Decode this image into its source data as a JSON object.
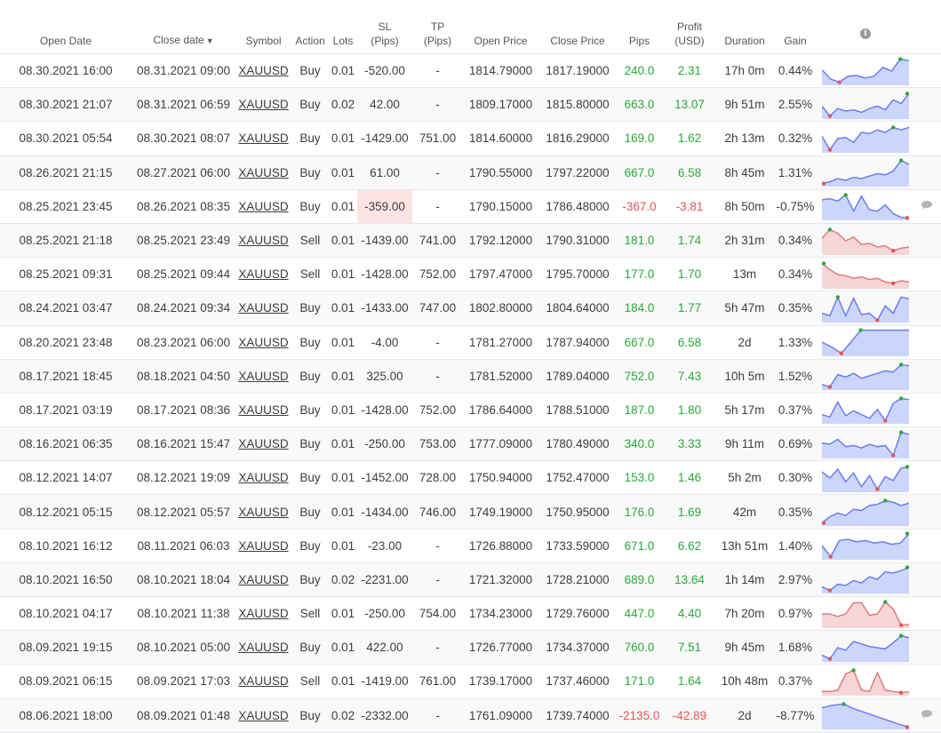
{
  "headers": {
    "open_date": "Open Date",
    "close_date": "Close date",
    "sort_indicator": "▼",
    "symbol": "Symbol",
    "action": "Action",
    "lots": "Lots",
    "sl": "SL",
    "sl_unit": "(Pips)",
    "tp": "TP",
    "tp_unit": "(Pips)",
    "open_price": "Open Price",
    "close_price": "Close Price",
    "pips": "Pips",
    "profit": "Profit",
    "profit_unit": "(USD)",
    "duration": "Duration",
    "gain": "Gain",
    "info_glyph": "i"
  },
  "colors": {
    "positive": "#2aa83a",
    "negative": "#e85454",
    "buy_line": "#6a7ef0",
    "buy_fill": "#ccd6fb",
    "sell_line": "#e27a7a",
    "sell_fill": "#f6d6d6",
    "marker_max": "#2aa83a",
    "marker_min": "#e85454"
  },
  "trades": [
    {
      "open": "08.30.2021 16:00",
      "close": "08.31.2021 09:00",
      "symbol": "XAUUSD",
      "action": "Buy",
      "lots": "0.01",
      "sl": "-520.00",
      "tp": "-",
      "open_price": "1814.79000",
      "close_price": "1817.19000",
      "pips": "240.0",
      "profit": "2.31",
      "duration": "17h 0m",
      "gain": "0.44%",
      "result": "win",
      "sl_highlight": false,
      "comment": false,
      "spark": [
        0.55,
        0.18,
        0.05,
        0.3,
        0.32,
        0.22,
        0.3,
        0.65,
        0.5,
        0.98,
        0.92
      ]
    },
    {
      "open": "08.30.2021 21:07",
      "close": "08.31.2021 06:59",
      "symbol": "XAUUSD",
      "action": "Buy",
      "lots": "0.02",
      "sl": "42.00",
      "tp": "-",
      "open_price": "1809.17000",
      "close_price": "1815.80000",
      "pips": "663.0",
      "profit": "13.07",
      "duration": "9h 51m",
      "gain": "2.55%",
      "result": "win",
      "sl_highlight": false,
      "comment": false,
      "spark": [
        0.45,
        0.05,
        0.35,
        0.25,
        0.3,
        0.2,
        0.35,
        0.45,
        0.3,
        0.7,
        0.55,
        0.95
      ]
    },
    {
      "open": "08.30.2021 05:54",
      "close": "08.30.2021 08:07",
      "symbol": "XAUUSD",
      "action": "Buy",
      "lots": "0.01",
      "sl": "-1429.00",
      "tp": "751.00",
      "open_price": "1814.60000",
      "close_price": "1816.29000",
      "pips": "169.0",
      "profit": "1.62",
      "duration": "2h 13m",
      "gain": "0.32%",
      "result": "win",
      "sl_highlight": false,
      "comment": false,
      "spark": [
        0.6,
        0.05,
        0.5,
        0.55,
        0.35,
        0.75,
        0.7,
        0.85,
        0.75,
        0.95,
        0.85,
        0.95
      ]
    },
    {
      "open": "08.26.2021 21:15",
      "close": "08.27.2021 06:00",
      "symbol": "XAUUSD",
      "action": "Buy",
      "lots": "0.01",
      "sl": "61.00",
      "tp": "-",
      "open_price": "1790.55000",
      "close_price": "1797.22000",
      "pips": "667.0",
      "profit": "6.58",
      "duration": "8h 45m",
      "gain": "1.31%",
      "result": "win",
      "sl_highlight": false,
      "comment": false,
      "spark": [
        0.05,
        0.12,
        0.25,
        0.18,
        0.3,
        0.25,
        0.35,
        0.45,
        0.4,
        0.55,
        0.98,
        0.82
      ]
    },
    {
      "open": "08.25.2021 23:45",
      "close": "08.26.2021 08:35",
      "symbol": "XAUUSD",
      "action": "Buy",
      "lots": "0.01",
      "sl": "-359.00",
      "tp": "-",
      "open_price": "1790.15000",
      "close_price": "1786.48000",
      "pips": "-367.0",
      "profit": "-3.81",
      "duration": "8h 50m",
      "gain": "-0.75%",
      "result": "loss",
      "sl_highlight": true,
      "comment": true,
      "spark": [
        0.75,
        0.8,
        0.7,
        0.95,
        0.3,
        0.9,
        0.35,
        0.3,
        0.55,
        0.2,
        0.05,
        0.03
      ]
    },
    {
      "open": "08.25.2021 21:18",
      "close": "08.25.2021 23:49",
      "symbol": "XAUUSD",
      "action": "Sell",
      "lots": "0.01",
      "sl": "-1439.00",
      "tp": "741.00",
      "open_price": "1792.12000",
      "close_price": "1790.31000",
      "pips": "181.0",
      "profit": "1.74",
      "duration": "2h 31m",
      "gain": "0.34%",
      "result": "win",
      "sl_highlight": false,
      "comment": false,
      "spark": [
        0.6,
        0.95,
        0.8,
        0.5,
        0.65,
        0.35,
        0.4,
        0.25,
        0.3,
        0.1,
        0.2,
        0.25
      ]
    },
    {
      "open": "08.25.2021 09:31",
      "close": "08.25.2021 09:44",
      "symbol": "XAUUSD",
      "action": "Sell",
      "lots": "0.01",
      "sl": "-1428.00",
      "tp": "752.00",
      "open_price": "1797.47000",
      "close_price": "1795.70000",
      "pips": "177.0",
      "profit": "1.70",
      "duration": "13m",
      "gain": "0.34%",
      "result": "win",
      "sl_highlight": false,
      "comment": false,
      "spark": [
        0.95,
        0.7,
        0.5,
        0.45,
        0.35,
        0.4,
        0.3,
        0.35,
        0.2,
        0.15,
        0.25,
        0.2
      ]
    },
    {
      "open": "08.24.2021 03:47",
      "close": "08.24.2021 09:34",
      "symbol": "XAUUSD",
      "action": "Buy",
      "lots": "0.01",
      "sl": "-1433.00",
      "tp": "747.00",
      "open_price": "1802.80000",
      "close_price": "1804.64000",
      "pips": "184.0",
      "profit": "1.77",
      "duration": "5h 47m",
      "gain": "0.35%",
      "result": "win",
      "sl_highlight": false,
      "comment": false,
      "spark": [
        0.3,
        0.2,
        0.95,
        0.2,
        0.9,
        0.25,
        0.3,
        0.02,
        0.6,
        0.3,
        0.95,
        0.88
      ]
    },
    {
      "open": "08.20.2021 23:48",
      "close": "08.23.2021 06:00",
      "symbol": "XAUUSD",
      "action": "Buy",
      "lots": "0.01",
      "sl": "-4.00",
      "tp": "-",
      "open_price": "1781.27000",
      "close_price": "1787.94000",
      "pips": "667.0",
      "profit": "6.58",
      "duration": "2d",
      "gain": "1.33%",
      "result": "win",
      "sl_highlight": false,
      "comment": false,
      "spark": [
        0.5,
        0.3,
        0.05,
        0.5,
        0.98,
        0.98,
        0.98,
        0.98,
        0.98,
        0.98
      ]
    },
    {
      "open": "08.17.2021 18:45",
      "close": "08.18.2021 04:50",
      "symbol": "XAUUSD",
      "action": "Buy",
      "lots": "0.01",
      "sl": "325.00",
      "tp": "-",
      "open_price": "1781.52000",
      "close_price": "1789.04000",
      "pips": "752.0",
      "profit": "7.43",
      "duration": "10h 5m",
      "gain": "1.52%",
      "result": "win",
      "sl_highlight": false,
      "comment": false,
      "spark": [
        0.15,
        0.05,
        0.55,
        0.45,
        0.6,
        0.4,
        0.5,
        0.6,
        0.7,
        0.65,
        0.95,
        0.9
      ]
    },
    {
      "open": "08.17.2021 03:19",
      "close": "08.17.2021 08:36",
      "symbol": "XAUUSD",
      "action": "Buy",
      "lots": "0.01",
      "sl": "-1428.00",
      "tp": "752.00",
      "open_price": "1786.64000",
      "close_price": "1788.51000",
      "pips": "187.0",
      "profit": "1.80",
      "duration": "5h 17m",
      "gain": "0.37%",
      "result": "win",
      "sl_highlight": false,
      "comment": false,
      "spark": [
        0.3,
        0.2,
        0.8,
        0.25,
        0.45,
        0.3,
        0.15,
        0.5,
        0.05,
        0.75,
        0.95,
        0.9
      ]
    },
    {
      "open": "08.16.2021 06:35",
      "close": "08.16.2021 15:47",
      "symbol": "XAUUSD",
      "action": "Buy",
      "lots": "0.01",
      "sl": "-250.00",
      "tp": "753.00",
      "open_price": "1777.09000",
      "close_price": "1780.49000",
      "pips": "340.0",
      "profit": "3.33",
      "duration": "9h 11m",
      "gain": "0.69%",
      "result": "win",
      "sl_highlight": false,
      "comment": false,
      "spark": [
        0.55,
        0.5,
        0.7,
        0.4,
        0.45,
        0.35,
        0.5,
        0.4,
        0.45,
        0.05,
        0.98,
        0.9
      ]
    },
    {
      "open": "08.12.2021 14:07",
      "close": "08.12.2021 19:09",
      "symbol": "XAUUSD",
      "action": "Buy",
      "lots": "0.01",
      "sl": "-1452.00",
      "tp": "728.00",
      "open_price": "1750.94000",
      "close_price": "1752.47000",
      "pips": "153.0",
      "profit": "1.46",
      "duration": "5h 2m",
      "gain": "0.30%",
      "result": "win",
      "sl_highlight": false,
      "comment": false,
      "spark": [
        0.75,
        0.5,
        0.85,
        0.35,
        0.7,
        0.15,
        0.6,
        0.05,
        0.55,
        0.4,
        0.9,
        0.95
      ]
    },
    {
      "open": "08.12.2021 05:15",
      "close": "08.12.2021 05:57",
      "symbol": "XAUUSD",
      "action": "Buy",
      "lots": "0.01",
      "sl": "-1434.00",
      "tp": "746.00",
      "open_price": "1749.19000",
      "close_price": "1750.95000",
      "pips": "176.0",
      "profit": "1.69",
      "duration": "42m",
      "gain": "0.35%",
      "result": "win",
      "sl_highlight": false,
      "comment": false,
      "spark": [
        0.05,
        0.3,
        0.45,
        0.35,
        0.6,
        0.55,
        0.75,
        0.8,
        0.95,
        0.88,
        0.75,
        0.85
      ]
    },
    {
      "open": "08.10.2021 16:12",
      "close": "08.11.2021 06:03",
      "symbol": "XAUUSD",
      "action": "Buy",
      "lots": "0.01",
      "sl": "-23.00",
      "tp": "-",
      "open_price": "1726.88000",
      "close_price": "1733.59000",
      "pips": "671.0",
      "profit": "6.62",
      "duration": "13h 51m",
      "gain": "1.40%",
      "result": "win",
      "sl_highlight": false,
      "comment": false,
      "spark": [
        0.5,
        0.05,
        0.7,
        0.75,
        0.65,
        0.7,
        0.6,
        0.65,
        0.55,
        0.6,
        0.98
      ]
    },
    {
      "open": "08.10.2021 16:50",
      "close": "08.10.2021 18:04",
      "symbol": "XAUUSD",
      "action": "Buy",
      "lots": "0.02",
      "sl": "-2231.00",
      "tp": "-",
      "open_price": "1721.32000",
      "close_price": "1728.21000",
      "pips": "689.0",
      "profit": "13.64",
      "duration": "1h 14m",
      "gain": "2.97%",
      "result": "win",
      "sl_highlight": false,
      "comment": false,
      "spark": [
        0.2,
        0.05,
        0.3,
        0.25,
        0.45,
        0.35,
        0.6,
        0.5,
        0.8,
        0.75,
        0.85,
        0.98
      ]
    },
    {
      "open": "08.10.2021 04:17",
      "close": "08.10.2021 11:38",
      "symbol": "XAUUSD",
      "action": "Sell",
      "lots": "0.01",
      "sl": "-250.00",
      "tp": "754.00",
      "open_price": "1734.23000",
      "close_price": "1729.76000",
      "pips": "447.0",
      "profit": "4.40",
      "duration": "7h 20m",
      "gain": "0.97%",
      "result": "win",
      "sl_highlight": false,
      "comment": false,
      "spark": [
        0.5,
        0.5,
        0.4,
        0.5,
        0.95,
        0.95,
        0.45,
        0.5,
        0.98,
        0.7,
        0.05,
        0.08
      ]
    },
    {
      "open": "08.09.2021 19:15",
      "close": "08.10.2021 05:00",
      "symbol": "XAUUSD",
      "action": "Buy",
      "lots": "0.01",
      "sl": "422.00",
      "tp": "-",
      "open_price": "1726.77000",
      "close_price": "1734.37000",
      "pips": "760.0",
      "profit": "7.51",
      "duration": "9h 45m",
      "gain": "1.68%",
      "result": "win",
      "sl_highlight": false,
      "comment": false,
      "spark": [
        0.2,
        0.05,
        0.5,
        0.4,
        0.75,
        0.65,
        0.55,
        0.5,
        0.45,
        0.7,
        0.98,
        0.9
      ]
    },
    {
      "open": "08.09.2021 06:15",
      "close": "08.09.2021 17:03",
      "symbol": "XAUUSD",
      "action": "Sell",
      "lots": "0.01",
      "sl": "-1419.00",
      "tp": "761.00",
      "open_price": "1739.17000",
      "close_price": "1737.46000",
      "pips": "171.0",
      "profit": "1.64",
      "duration": "10h 48m",
      "gain": "0.37%",
      "result": "win",
      "sl_highlight": false,
      "comment": false,
      "spark": [
        0.1,
        0.1,
        0.15,
        0.8,
        0.95,
        0.15,
        0.1,
        0.85,
        0.15,
        0.1,
        0.05,
        0.08
      ]
    },
    {
      "open": "08.06.2021 18:00",
      "close": "08.09.2021 01:48",
      "symbol": "XAUUSD",
      "action": "Buy",
      "lots": "0.02",
      "sl": "-2332.00",
      "tp": "-",
      "open_price": "1761.09000",
      "close_price": "1739.74000",
      "pips": "-2135.0",
      "profit": "-42.89",
      "duration": "2d",
      "gain": "-8.77%",
      "result": "loss",
      "sl_highlight": false,
      "comment": true,
      "spark": [
        0.8,
        0.9,
        0.95,
        0.75,
        0.6,
        0.45,
        0.3,
        0.15,
        0.02
      ]
    }
  ]
}
